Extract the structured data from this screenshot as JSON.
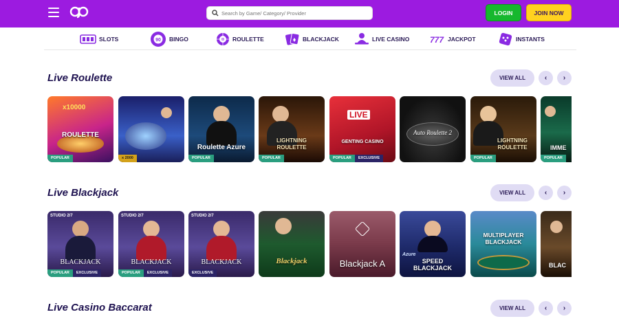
{
  "header": {
    "search_placeholder": "Search by Game/ Category/ Provider",
    "login_label": "LOGIN",
    "join_label": "JOIN NOW",
    "brand_color": "#9c1be0"
  },
  "nav": {
    "items": [
      {
        "label": "SLOTS",
        "icon": "slots-icon"
      },
      {
        "label": "BINGO",
        "icon": "bingo-icon"
      },
      {
        "label": "ROULETTE",
        "icon": "roulette-icon"
      },
      {
        "label": "BLACKJACK",
        "icon": "cards-icon"
      },
      {
        "label": "LIVE CASINO",
        "icon": "dealer-icon"
      },
      {
        "label": "JACKPOT",
        "icon": "jackpot-777-icon"
      },
      {
        "label": "INSTANTS",
        "icon": "dice-icon"
      }
    ]
  },
  "sections": [
    {
      "title": "Live Roulette",
      "view_all": "VIEW ALL",
      "tiles": [
        {
          "name": "ROULETTE",
          "top": "x10000",
          "badges": [
            "POPULAR"
          ]
        },
        {
          "name": "",
          "top": "",
          "badges": [
            "x 2000"
          ]
        },
        {
          "name": "Roulette Azure",
          "top": "",
          "badges": [
            "POPULAR"
          ]
        },
        {
          "name": "LIGHTNING ROULETTE",
          "top": "",
          "badges": [
            "POPULAR"
          ]
        },
        {
          "name": "GENTING CASINO",
          "top": "LIVE",
          "badges": [
            "POPULAR",
            "EXCLUSIVE"
          ]
        },
        {
          "name": "Auto Roulette 2",
          "top": "",
          "badges": []
        },
        {
          "name": "LIGHTNING ROULETTE",
          "top": "",
          "badges": [
            "POPULAR"
          ]
        },
        {
          "name": "IMME",
          "top": "",
          "badges": [
            "POPULAR"
          ]
        }
      ]
    },
    {
      "title": "Live Blackjack",
      "view_all": "VIEW ALL",
      "tiles": [
        {
          "name": "BLACKJACK",
          "top": "STUDIO 2/7",
          "badges": [
            "POPULAR",
            "EXCLUSIVE"
          ]
        },
        {
          "name": "BLACKJACK",
          "top": "STUDIO 2/7",
          "badges": [
            "POPULAR",
            "EXCLUSIVE"
          ]
        },
        {
          "name": "BLACKJACK",
          "top": "STUDIO 2/7",
          "badges": [
            "EXCLUSIVE"
          ]
        },
        {
          "name": "Blackjack",
          "top": "",
          "badges": []
        },
        {
          "name": "Blackjack A",
          "top": "",
          "badges": []
        },
        {
          "name": "SPEED BLACKJACK",
          "top": "Azure",
          "badges": []
        },
        {
          "name": "MULTIPLAYER BLACKJACK",
          "top": "",
          "badges": []
        },
        {
          "name": "BLAC",
          "top": "",
          "badges": []
        }
      ]
    },
    {
      "title": "Live Casino Baccarat",
      "view_all": "VIEW ALL"
    }
  ],
  "arrows": {
    "prev": "‹",
    "next": "›"
  }
}
